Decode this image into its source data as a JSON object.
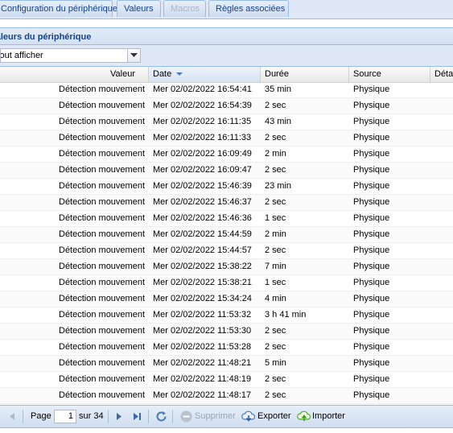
{
  "tabs": [
    {
      "label": "Configuration du périphérique",
      "state": "normal"
    },
    {
      "label": "Valeurs",
      "state": "active"
    },
    {
      "label": "Macros",
      "state": "disabled"
    },
    {
      "label": "Règles associées",
      "state": "normal"
    }
  ],
  "panel": {
    "title": "Valeurs du périphérique"
  },
  "filter": {
    "value": "Tout afficher"
  },
  "columns": {
    "valeur": "Valeur",
    "date": "Date",
    "duree": "Durée",
    "source": "Source",
    "details": "Détails"
  },
  "rows": [
    {
      "valeur": "Détection mouvement",
      "date": "Mer 02/02/2022 16:54:41",
      "duree": "35 min",
      "source": "Physique"
    },
    {
      "valeur": "Détection mouvement",
      "date": "Mer 02/02/2022 16:54:39",
      "duree": "2 sec",
      "source": "Physique"
    },
    {
      "valeur": "Détection mouvement",
      "date": "Mer 02/02/2022 16:11:35",
      "duree": "43 min",
      "source": "Physique"
    },
    {
      "valeur": "Détection mouvement",
      "date": "Mer 02/02/2022 16:11:33",
      "duree": "2 sec",
      "source": "Physique"
    },
    {
      "valeur": "Détection mouvement",
      "date": "Mer 02/02/2022 16:09:49",
      "duree": "2 min",
      "source": "Physique"
    },
    {
      "valeur": "Détection mouvement",
      "date": "Mer 02/02/2022 16:09:47",
      "duree": "2 sec",
      "source": "Physique"
    },
    {
      "valeur": "Détection mouvement",
      "date": "Mer 02/02/2022 15:46:39",
      "duree": "23 min",
      "source": "Physique"
    },
    {
      "valeur": "Détection mouvement",
      "date": "Mer 02/02/2022 15:46:37",
      "duree": "2 sec",
      "source": "Physique"
    },
    {
      "valeur": "Détection mouvement",
      "date": "Mer 02/02/2022 15:46:36",
      "duree": "1 sec",
      "source": "Physique"
    },
    {
      "valeur": "Détection mouvement",
      "date": "Mer 02/02/2022 15:44:59",
      "duree": "2 min",
      "source": "Physique"
    },
    {
      "valeur": "Détection mouvement",
      "date": "Mer 02/02/2022 15:44:57",
      "duree": "2 sec",
      "source": "Physique"
    },
    {
      "valeur": "Détection mouvement",
      "date": "Mer 02/02/2022 15:38:22",
      "duree": "7 min",
      "source": "Physique"
    },
    {
      "valeur": "Détection mouvement",
      "date": "Mer 02/02/2022 15:38:21",
      "duree": "1 sec",
      "source": "Physique"
    },
    {
      "valeur": "Détection mouvement",
      "date": "Mer 02/02/2022 15:34:24",
      "duree": "4 min",
      "source": "Physique"
    },
    {
      "valeur": "Détection mouvement",
      "date": "Mer 02/02/2022 11:53:32",
      "duree": "3 h 41 min",
      "source": "Physique"
    },
    {
      "valeur": "Détection mouvement",
      "date": "Mer 02/02/2022 11:53:30",
      "duree": "2 sec",
      "source": "Physique"
    },
    {
      "valeur": "Détection mouvement",
      "date": "Mer 02/02/2022 11:53:28",
      "duree": "2 sec",
      "source": "Physique"
    },
    {
      "valeur": "Détection mouvement",
      "date": "Mer 02/02/2022 11:48:21",
      "duree": "5 min",
      "source": "Physique"
    },
    {
      "valeur": "Détection mouvement",
      "date": "Mer 02/02/2022 11:48:19",
      "duree": "2 sec",
      "source": "Physique"
    },
    {
      "valeur": "Détection mouvement",
      "date": "Mer 02/02/2022 11:48:17",
      "duree": "2 sec",
      "source": "Physique"
    }
  ],
  "pager": {
    "page_label": "Page",
    "page_value": "1",
    "of_label": "sur 34",
    "delete_label": "Supprimer",
    "export_label": "Exporter",
    "import_label": "Importer"
  },
  "colors": {
    "accent": "#15428b",
    "border": "#99bbe8",
    "import_green": "#4caf28"
  }
}
